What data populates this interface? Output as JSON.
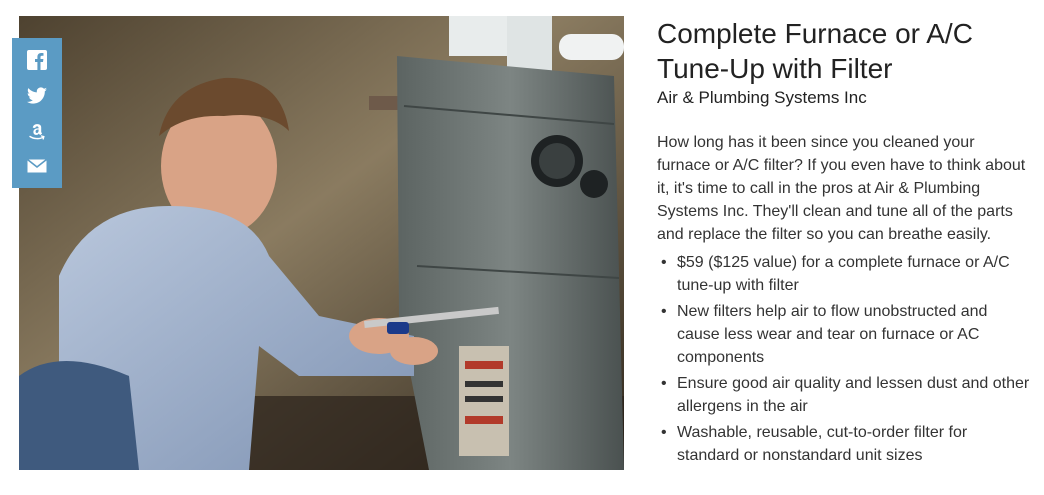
{
  "photo": {
    "alt": "Technician tuning up a furnace"
  },
  "share": [
    {
      "name": "facebook-icon",
      "glyph": "f"
    },
    {
      "name": "twitter-icon",
      "glyph": "t"
    },
    {
      "name": "amazon-icon",
      "glyph": "a"
    },
    {
      "name": "email-icon",
      "glyph": "mail"
    }
  ],
  "deal": {
    "title": "Complete Furnace or A/C Tune-Up with Filter",
    "merchant": "Air & Plumbing Systems Inc",
    "description": "How long has it been since you cleaned your furnace or A/C filter? If you even have to think about it, it's time to call in the pros at Air & Plumbing Systems Inc. They'll clean and tune all of the parts and replace the filter so you can breathe easily.",
    "bullets": [
      "$59 ($125 value) for a complete furnace or A/C tune-up with filter",
      "New filters help air to flow unobstructed and cause less wear and tear on furnace or AC components",
      "Ensure good air quality and lessen dust and other allergens in the air",
      "Washable, reusable, cut-to-order filter for standard or nonstandard unit sizes"
    ]
  },
  "colors": {
    "share_bar": "#5b9bc4",
    "text": "#333333",
    "title": "#222222"
  }
}
